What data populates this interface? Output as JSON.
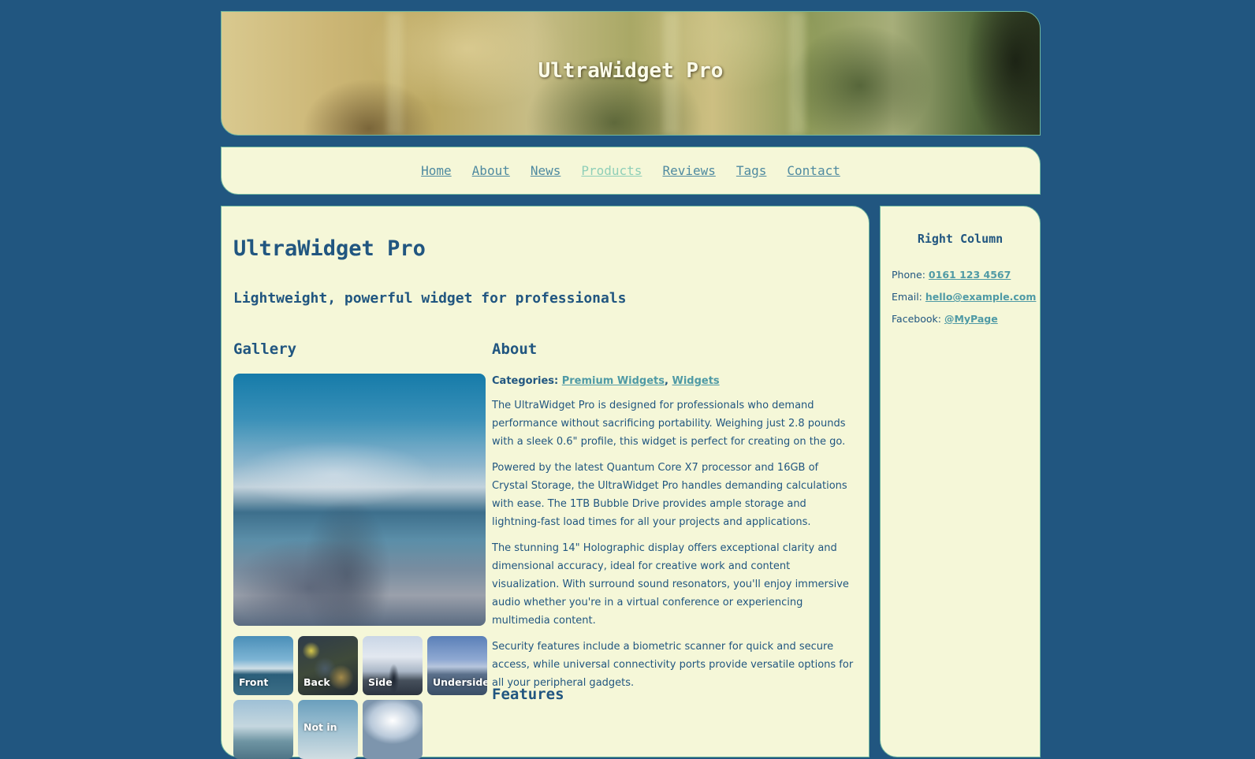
{
  "header": {
    "title": "UltraWidget Pro"
  },
  "nav": {
    "items": [
      {
        "label": "Home"
      },
      {
        "label": "About"
      },
      {
        "label": "News"
      },
      {
        "label": "Products",
        "active": true
      },
      {
        "label": "Reviews"
      },
      {
        "label": "Tags"
      },
      {
        "label": "Contact"
      }
    ]
  },
  "main": {
    "title": "UltraWidget Pro",
    "subtitle": "Lightweight, powerful widget for professionals",
    "gallery": {
      "heading": "Gallery",
      "thumbnails": [
        {
          "label": "Front"
        },
        {
          "label": "Back"
        },
        {
          "label": "Side"
        },
        {
          "label": "Underside"
        },
        {
          "label": ""
        },
        {
          "label": "Not in"
        },
        {
          "label": ""
        }
      ]
    },
    "about": {
      "heading": "About",
      "categories_label": "Categories:",
      "categories": [
        "Premium Widgets",
        "Widgets"
      ],
      "category_separator": ",",
      "paragraphs": [
        "The UltraWidget Pro is designed for professionals who demand performance without sacrificing portability. Weighing just 2.8 pounds with a sleek 0.6\" profile, this widget is perfect for creating on the go.",
        "Powered by the latest Quantum Core X7 processor and 16GB of Crystal Storage, the UltraWidget Pro handles demanding calculations with ease. The 1TB Bubble Drive provides ample storage and lightning-fast load times for all your projects and applications.",
        "The stunning 14\" Holographic display offers exceptional clarity and dimensional accuracy, ideal for creative work and content visualization. With surround sound resonators, you'll enjoy immersive audio whether you're in a virtual conference or experiencing multimedia content.",
        "Security features include a biometric scanner for quick and secure access, while universal connectivity ports provide versatile options for all your peripheral gadgets."
      ]
    },
    "features": {
      "heading": "Features"
    }
  },
  "sidebar": {
    "title": "Right Column",
    "phone_label": "Phone:",
    "phone": "0161 123 4567",
    "email_label": "Email:",
    "email": "hello@example.com",
    "facebook_label": "Facebook:",
    "facebook": "@MyPage"
  }
}
